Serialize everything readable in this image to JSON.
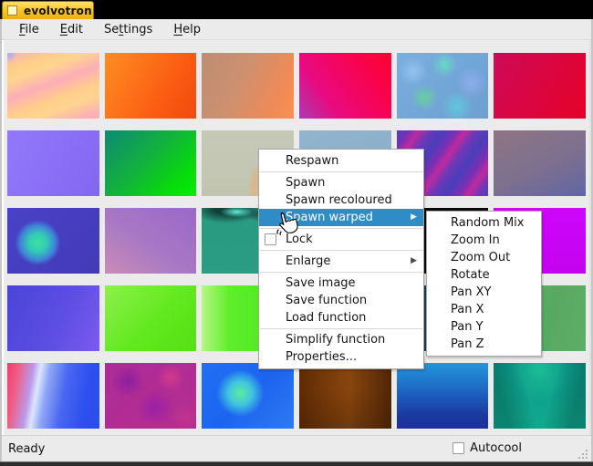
{
  "window": {
    "title": "evolvotron"
  },
  "colors": {
    "highlight": "#308cc6",
    "titlebar_tab_gold": "#f8c62c",
    "titlebar_bg": "#000000",
    "chrome_bg": "#ebebeb",
    "menu_bg": "#ffffff"
  },
  "menubar": {
    "items": [
      {
        "pre": "",
        "mn": "F",
        "post": "ile"
      },
      {
        "pre": "",
        "mn": "E",
        "post": "dit"
      },
      {
        "pre": "Se",
        "mn": "t",
        "post": "tings"
      },
      {
        "pre": "",
        "mn": "H",
        "post": "elp"
      }
    ]
  },
  "context_menu": {
    "items": [
      {
        "label": "Respawn"
      },
      {
        "label": "Spawn"
      },
      {
        "label": "Spawn recoloured"
      },
      {
        "label": "Spawn warped",
        "highlighted": true,
        "has_submenu": true
      },
      {
        "label": "Lock",
        "checkbox": true,
        "checked": false
      },
      {
        "label": "Enlarge",
        "has_submenu": true
      },
      {
        "label": "Save image"
      },
      {
        "label": "Save function"
      },
      {
        "label": "Load function"
      },
      {
        "label": "Simplify function"
      },
      {
        "label": "Properties..."
      }
    ],
    "submenu_arrow": "▶"
  },
  "submenu": {
    "items": [
      "Random Mix",
      "Zoom In",
      "Zoom Out",
      "Rotate",
      "Pan XY",
      "Pan X",
      "Pan Y",
      "Pan Z"
    ]
  },
  "statusbar": {
    "status": "Ready",
    "autocool_label": "Autocool",
    "autocool_checked": false
  },
  "grid": {
    "rows": 5,
    "cols": 6,
    "tiles": [
      {
        "name": "peach-pink-diagonal-stripes",
        "bg": "radial-gradient(circle 9px at 2% 3%, #a9b2ee 0%, rgba(169,178,238,0) 100%), repeating-linear-gradient(160deg, #fcaeb6 0px, #ffce8a 18px, #ffd490 30px, #fcaeb6 48px)"
      },
      {
        "name": "orange-gradient",
        "bg": "linear-gradient(120deg, #ff8d22 0%, #fa5c12 65%, #f04a0e 100%)"
      },
      {
        "name": "tan-orange-gradient",
        "bg": "linear-gradient(115deg, #bd8d72 0%, #cc9070 40%, #f08a56 80%, #f99052 100%)"
      },
      {
        "name": "magenta-red-gradient",
        "bg": "linear-gradient(55deg, #a93cb4 0%, #e90a80 30%, #f80350 70%, #fb0331 100%)"
      },
      {
        "name": "blue-mottled-noise",
        "bg": "radial-gradient(circle 16px at 18% 28%, #93c2f2 0%, rgba(147,194,242,0) 100%), radial-gradient(circle 14px at 52% 18%, #66d9c4 0%, rgba(102,217,196,0) 100%), radial-gradient(circle 17px at 82% 45%, #8cacec 0%, rgba(140,172,236,0) 100%), radial-gradient(circle 15px at 30% 68%, #66cf9e 0%, rgba(102,207,158,0) 100%), radial-gradient(circle 18px at 66% 82%, #5fc6da 0%, rgba(95,198,218,0) 100%), linear-gradient(135deg, #79aede 0%, #6d9fd2 100%)",
        "note": ""
      },
      {
        "name": "crimson-gradient",
        "bg": "linear-gradient(120deg, #ce0a58 0%, #da0540 50%, #e60227 100%)"
      },
      {
        "name": "periwinkle-flat",
        "bg": "linear-gradient(300deg, #8266f0 0%, #8b71f7 55%, #9278f8 100%)"
      },
      {
        "name": "teal-green-gradient",
        "bg": "linear-gradient(135deg, #0d8a74 0%, #13b13e 45%, #06dd08 80%, #03ee03 100%)"
      },
      {
        "name": "sage-with-tan-shape",
        "bg": "radial-gradient(ellipse 16px 40px at 62% 92%, #dab88e 45%, rgba(218,184,142,0) 75%), linear-gradient(180deg, #c6c9b7 0%, #c0c4b0 100%)"
      },
      {
        "name": "steel-blue-flat",
        "bg": "linear-gradient(160deg, #92b4cf 0%, #87abc7 100%)"
      },
      {
        "name": "purple-magenta-stripes",
        "bg": "repeating-linear-gradient(125deg, #4a3eba 0px, #7b2fb4 12px, #bf2a9e 20px, #6c38b8 30px, #4a3eba 42px)"
      },
      {
        "name": "mauve-slate-gradient",
        "bg": "linear-gradient(155deg, #8e7582 0%, #7d7090 55%, #6066a4 100%)"
      },
      {
        "name": "indigo-with-green-sphere",
        "bg": "radial-gradient(circle 25px at 33% 53%, #3ce2a0 0%, #32cbb4 40%, #3f85d8 75%, rgba(72,66,198,0) 100%), linear-gradient(135deg, #4a42c6 0%, #423ab8 100%)"
      },
      {
        "name": "purple-pink-gradient",
        "bg": "linear-gradient(215deg, #9968c9 0%, #a878c4 55%, #ca8cb6 100%)"
      },
      {
        "name": "teal-with-dark-swirl",
        "bg": "radial-gradient(ellipse 30px 10px at 38% 6%, #5ef2d8 0%, rgba(94,242,216,0) 60%), radial-gradient(ellipse 55px 22px at 28% 2%, #123f3a 25%, rgba(18,63,58,0) 70%), radial-gradient(ellipse 40px 14px at 70% 10%, #16524a 15%, rgba(22,82,74,0) 60%), linear-gradient(180deg, #279a80 0%, #2a9d84 100%)"
      },
      {
        "name": "hidden-under-menu",
        "bg": "#9a9a9a"
      },
      {
        "name": "black-flat",
        "bg": "#0a0a0a"
      },
      {
        "name": "vivid-magenta-flat",
        "bg": "linear-gradient(180deg, #cd06fa 0%, #c403ef 100%)"
      },
      {
        "name": "indigo-violet-gradient",
        "bg": "linear-gradient(115deg, #4a45d6 0%, #5c4ee2 55%, #7d5af0 100%)"
      },
      {
        "name": "bright-green-gradient",
        "bg": "linear-gradient(135deg, #8df04c 0%, #62e81e 55%, #54e014 100%)"
      },
      {
        "name": "green-light-left-edge",
        "bg": "linear-gradient(90deg, #b4f882 0%, #5fee2a 30%, #42e61c 100%)"
      },
      {
        "name": "hidden-under-menu",
        "bg": "#9a9a9a"
      },
      {
        "name": "hidden-under-submenu",
        "bg": "#16424e"
      },
      {
        "name": "medium-green-flat",
        "bg": "linear-gradient(105deg, #66b46c 0%, #58a862 60%, #5fae68 100%)"
      },
      {
        "name": "pink-blue-vertical-bands",
        "bg": "linear-gradient(100deg, #f23a6e 0%, #ee5f88 12%, #bb99e9 26%, #dde6fe 33%, #8fa7f6 42%, #4a66f2 60%, #2e50ee 82%, #2a4cec 100%)"
      },
      {
        "name": "magenta-noise",
        "bg": "radial-gradient(circle 18px at 25% 28%, #8c1f9e 0%, rgba(140,31,158,0) 100%), radial-gradient(circle 15px at 72% 22%, #d23a8c 0%, rgba(210,58,140,0) 100%), radial-gradient(circle 20px at 55% 68%, #9a20a6 0%, rgba(154,32,166,0) 100%), radial-gradient(circle 16px at 88% 82%, #c23390 0%, rgba(194,51,144,0) 100%), linear-gradient(135deg, #ae2b98 0%, #b42e90 100%)"
      },
      {
        "name": "blue-with-green-glow",
        "bg": "radial-gradient(circle 26px at 42% 46%, #5deb9e 0%, #40c4e0 50%, rgba(64,196,224,0) 100%), linear-gradient(135deg, #2170f4 0%, #1c64f0 50%, #2e7af2 100%)"
      },
      {
        "name": "brown-gradient",
        "bg": "linear-gradient(180deg, rgba(0,0,0,0) 40%, rgba(40,16,0,0.25) 100%), linear-gradient(90deg, #5e2b06 0%, #7c3d0a 35%, #88460e 55%, #64300a 85%, #502706 100%)"
      },
      {
        "name": "blue-vertical-gradient",
        "bg": "linear-gradient(180deg, #2496dc 0%, #1d63c0 45%, #1b3aa2 78%, #1c3098 100%)"
      },
      {
        "name": "teal-chevron",
        "bg": "linear-gradient(75deg, rgba(6,84,74,0.45) 15%, rgba(6,84,74,0) 40%), linear-gradient(285deg, rgba(6,84,74,0.45) 15%, rgba(6,84,74,0) 40%), radial-gradient(ellipse 45px 50px at 50% 10%, #1cbc96 0%, rgba(28,188,150,0) 70%), linear-gradient(180deg, #0b9a8a 0%, #12a98e 100%)"
      }
    ]
  }
}
